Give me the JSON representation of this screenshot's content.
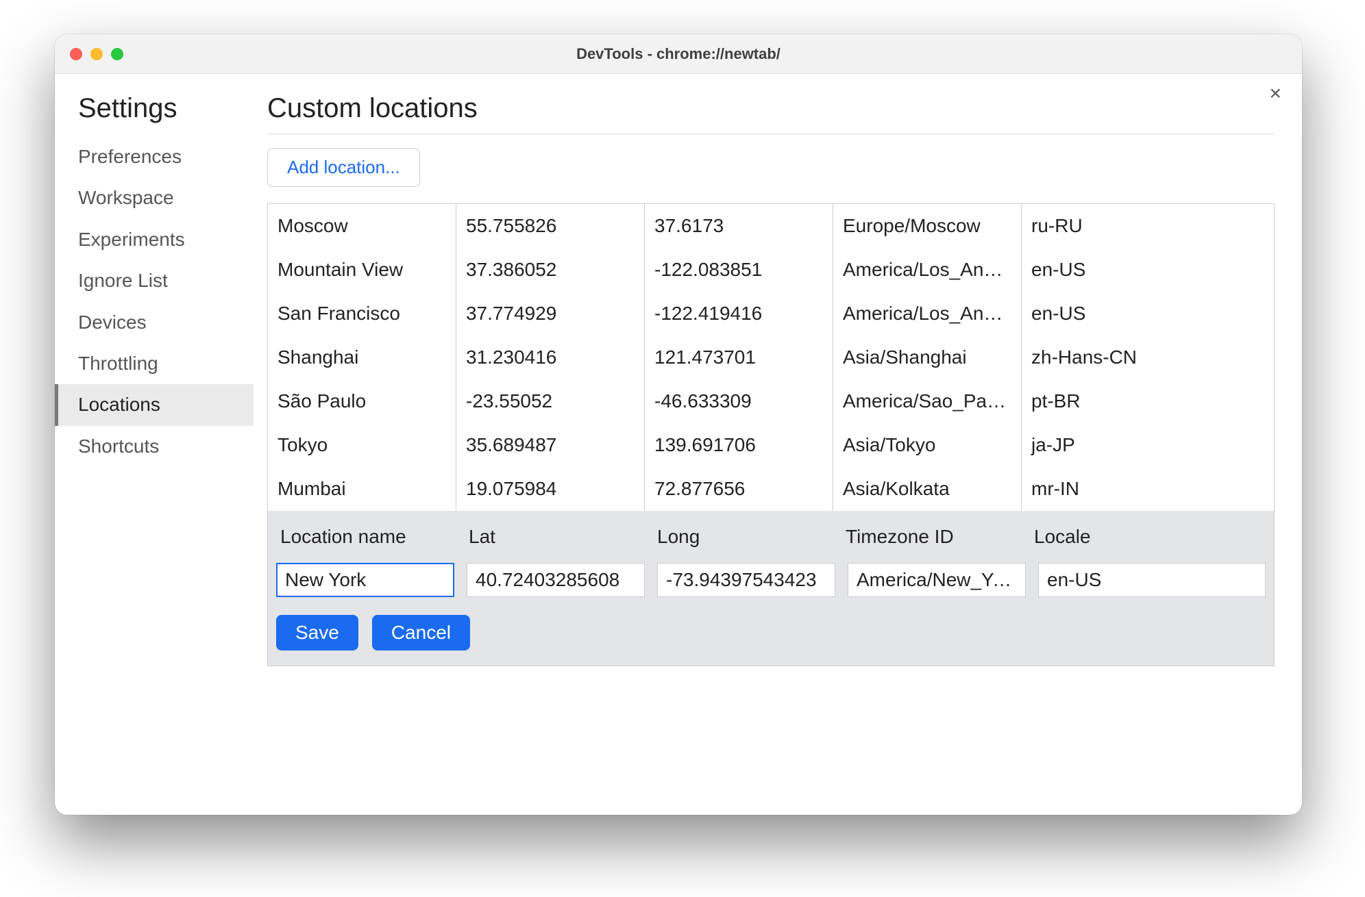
{
  "window": {
    "title": "DevTools - chrome://newtab/"
  },
  "close_label": "×",
  "sidebar": {
    "title": "Settings",
    "items": [
      {
        "label": "Preferences"
      },
      {
        "label": "Workspace"
      },
      {
        "label": "Experiments"
      },
      {
        "label": "Ignore List"
      },
      {
        "label": "Devices"
      },
      {
        "label": "Throttling"
      },
      {
        "label": "Locations"
      },
      {
        "label": "Shortcuts"
      }
    ],
    "selected_index": 6
  },
  "main": {
    "title": "Custom locations",
    "add_button": "Add location...",
    "rows": [
      {
        "name": "Moscow",
        "lat": "55.755826",
        "long": "37.6173",
        "tz": "Europe/Moscow",
        "locale": "ru-RU"
      },
      {
        "name": "Mountain View",
        "lat": "37.386052",
        "long": "-122.083851",
        "tz": "America/Los_An…",
        "locale": "en-US"
      },
      {
        "name": "San Francisco",
        "lat": "37.774929",
        "long": "-122.419416",
        "tz": "America/Los_An…",
        "locale": "en-US"
      },
      {
        "name": "Shanghai",
        "lat": "31.230416",
        "long": "121.473701",
        "tz": "Asia/Shanghai",
        "locale": "zh-Hans-CN"
      },
      {
        "name": "São Paulo",
        "lat": "-23.55052",
        "long": "-46.633309",
        "tz": "America/Sao_Pa…",
        "locale": "pt-BR"
      },
      {
        "name": "Tokyo",
        "lat": "35.689487",
        "long": "139.691706",
        "tz": "Asia/Tokyo",
        "locale": "ja-JP"
      },
      {
        "name": "Mumbai",
        "lat": "19.075984",
        "long": "72.877656",
        "tz": "Asia/Kolkata",
        "locale": "mr-IN"
      }
    ],
    "editor": {
      "headers": {
        "name": "Location name",
        "lat": "Lat",
        "long": "Long",
        "tz": "Timezone ID",
        "locale": "Locale"
      },
      "values": {
        "name": "New York",
        "lat": "40.72403285608",
        "long": "-73.94397543423",
        "tz": "America/New_York",
        "locale": "en-US"
      },
      "save_label": "Save",
      "cancel_label": "Cancel"
    }
  }
}
